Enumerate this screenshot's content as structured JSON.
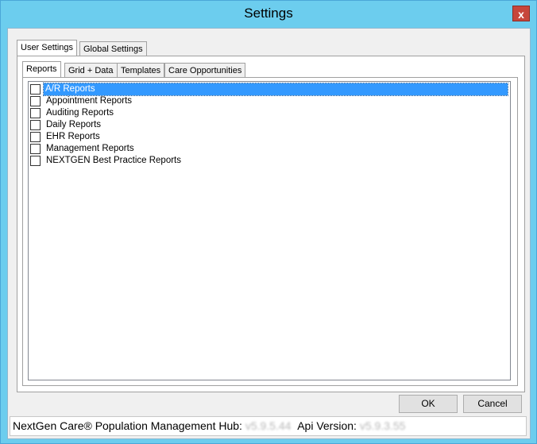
{
  "window": {
    "title": "Settings",
    "close_label": "x"
  },
  "outer_tabs": [
    {
      "label": "User Settings"
    },
    {
      "label": "Global Settings"
    }
  ],
  "inner_tabs": [
    {
      "label": "Reports"
    },
    {
      "label": "Grid + Data"
    },
    {
      "label": "Templates"
    },
    {
      "label": "Care Opportunities"
    }
  ],
  "report_list": [
    {
      "label": "A/R Reports",
      "checked": false,
      "selected": true
    },
    {
      "label": "Appointment Reports",
      "checked": false,
      "selected": false
    },
    {
      "label": "Auditing Reports",
      "checked": false,
      "selected": false
    },
    {
      "label": "Daily Reports",
      "checked": false,
      "selected": false
    },
    {
      "label": "EHR Reports",
      "checked": false,
      "selected": false
    },
    {
      "label": "Management Reports",
      "checked": false,
      "selected": false
    },
    {
      "label": "NEXTGEN Best Practice Reports",
      "checked": false,
      "selected": false
    }
  ],
  "buttons": {
    "ok": "OK",
    "cancel": "Cancel"
  },
  "status_bar": {
    "app_label": "NextGen Care® Population Management Hub:",
    "app_version": "v5.9.5.44",
    "api_label": "Api Version:",
    "api_version": "v5.9.3.55"
  }
}
